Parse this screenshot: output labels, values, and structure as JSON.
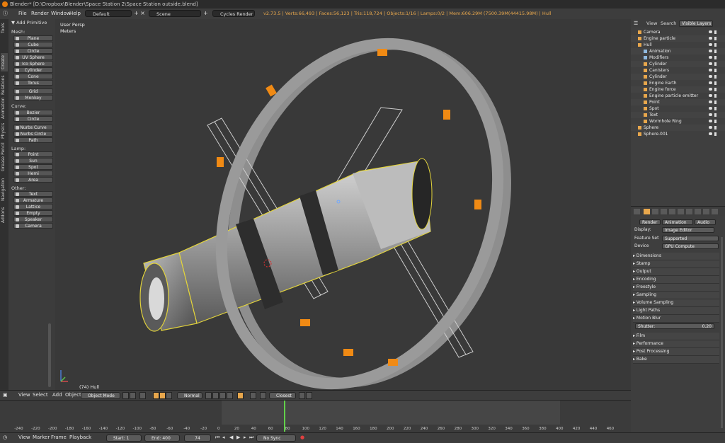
{
  "window": {
    "title": "Blender* [D:\\Dropbox\\Blender\\Space Station 2\\Space Station outside.blend]"
  },
  "menu": {
    "items": [
      "File",
      "Render",
      "Window",
      "Help"
    ],
    "layout": "Default",
    "scene": "Scene",
    "engine": "Cycles Render",
    "stats": "v2.73.5 | Verts:66,493 | Faces:56,123 | Tris:118,724 | Objects:1/16 | Lamps:0/2 | Mem:606.29M (7500.39M(44415.98M) | Hull"
  },
  "left_tabs": [
    "Tools",
    "Create",
    "Relations",
    "Animation",
    "Physics",
    "Grease Pencil",
    "Navigation",
    "Addons"
  ],
  "toolshelf": {
    "header": "▼ Add Primitive",
    "sections": [
      {
        "title": "Mesh:",
        "items": [
          "Plane",
          "Cube",
          "Circle",
          "UV Sphere",
          "Ico Sphere",
          "Cylinder",
          "Cone",
          "Torus"
        ]
      },
      {
        "title": "",
        "items": [
          "Grid",
          "Monkey"
        ]
      },
      {
        "title": "Curve:",
        "items": [
          "Bezier",
          "Circle"
        ]
      },
      {
        "title": "",
        "items": [
          "Nurbs Curve",
          "Nurbs Circle",
          "Path"
        ]
      },
      {
        "title": "Lamp:",
        "items": [
          "Point",
          "Sun",
          "Spot",
          "Hemi",
          "Area"
        ]
      },
      {
        "title": "Other:",
        "items": [
          "Text",
          "Armature",
          "Lattice",
          "Empty",
          "Speaker",
          "Camera"
        ]
      }
    ]
  },
  "viewport": {
    "perspective": "User Persp",
    "units": "Meters",
    "object_label": "(74) Hull"
  },
  "view_header": {
    "menus": [
      "View",
      "Select",
      "Add",
      "Object"
    ],
    "mode": "Object Mode",
    "pivot": "Normal",
    "snap": "Closest"
  },
  "timeline": {
    "ticks": [
      "-240",
      "-220",
      "-200",
      "-180",
      "-160",
      "-140",
      "-120",
      "-100",
      "-80",
      "-60",
      "-40",
      "-20",
      "0",
      "20",
      "40",
      "60",
      "80",
      "100",
      "120",
      "140",
      "160",
      "180",
      "200",
      "220",
      "240",
      "260",
      "280",
      "300",
      "320",
      "340",
      "360",
      "380",
      "400",
      "420",
      "440",
      "460"
    ],
    "current_frame": 74,
    "start": 0,
    "end": 400
  },
  "timeline_header": {
    "menus": [
      "View",
      "Marker",
      "Frame",
      "Playback"
    ],
    "start_label": "Start:",
    "start_value": "1",
    "end_label": "End:",
    "end_value": "400",
    "current": "74",
    "sync": "No Sync"
  },
  "outliner": {
    "header": [
      "View",
      "Search",
      "Visible Layers"
    ],
    "rows": [
      {
        "label": "Camera",
        "indent": 0,
        "color": "#e8a74c"
      },
      {
        "label": "Engine particle",
        "indent": 0,
        "color": "#e8a74c"
      },
      {
        "label": "Hull",
        "indent": 0,
        "color": "#e8a74c"
      },
      {
        "label": "Animation",
        "indent": 1,
        "color": "#8fb8de"
      },
      {
        "label": "Modifiers",
        "indent": 1,
        "color": "#8fb8de"
      },
      {
        "label": "Cylinder",
        "indent": 1,
        "color": "#e8a74c"
      },
      {
        "label": "Canisters",
        "indent": 1,
        "color": "#e8a74c"
      },
      {
        "label": "Cylinder",
        "indent": 1,
        "color": "#e8a74c"
      },
      {
        "label": "Engine Earth",
        "indent": 1,
        "color": "#e8a74c"
      },
      {
        "label": "Engine force",
        "indent": 1,
        "color": "#e8a74c"
      },
      {
        "label": "Engine particle emitter",
        "indent": 1,
        "color": "#e8a74c"
      },
      {
        "label": "Point",
        "indent": 1,
        "color": "#e8a74c"
      },
      {
        "label": "Spot",
        "indent": 1,
        "color": "#e8a74c"
      },
      {
        "label": "Text",
        "indent": 1,
        "color": "#e8a74c"
      },
      {
        "label": "Wormhole Ring",
        "indent": 1,
        "color": "#e8a74c"
      },
      {
        "label": "Sphere",
        "indent": 0,
        "color": "#e8a74c"
      },
      {
        "label": "Sphere.001",
        "indent": 0,
        "color": "#e8a74c"
      }
    ]
  },
  "properties": {
    "buttons": [
      "Render",
      "Animation",
      "Audio"
    ],
    "display_label": "Display:",
    "display_value": "Image Editor",
    "feature_label": "Feature Set",
    "feature_value": "Supported",
    "device_label": "Device",
    "device_value": "GPU Compute",
    "panels": [
      "Dimensions",
      "Stamp",
      "Output",
      "Encoding",
      "Freestyle",
      "Sampling",
      "Volume Sampling",
      "Light Paths",
      "Motion Blur"
    ],
    "shutter_label": "Shutter:",
    "shutter_value": "0.20",
    "panels_after": [
      "Film",
      "Performance",
      "Post Processing",
      "Bake"
    ]
  },
  "colors": {
    "accent": "#e8a74c",
    "selection": "#f0e040"
  }
}
